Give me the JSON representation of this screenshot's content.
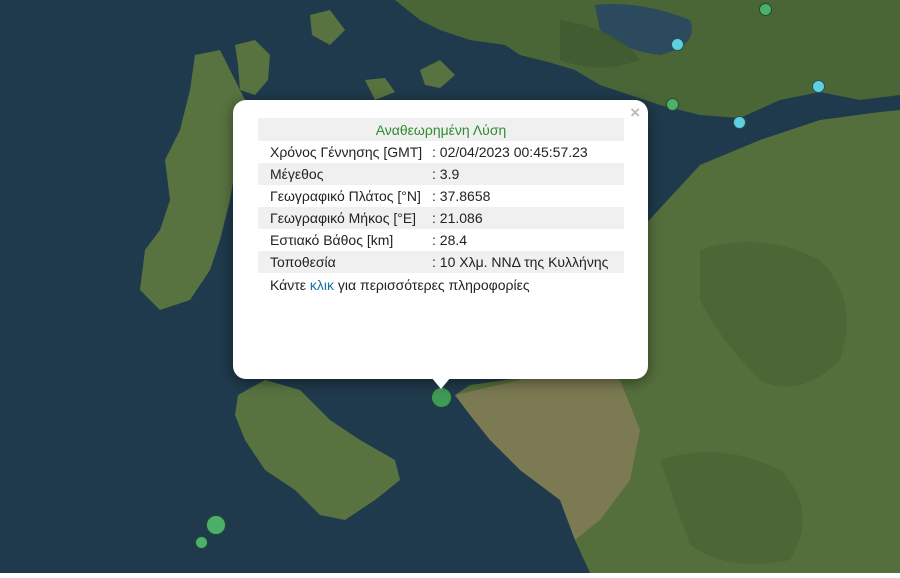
{
  "popup": {
    "title": "Αναθεωρημένη Λύση",
    "rows": [
      {
        "label": "Χρόνος Γέννησης [GMT]",
        "value": ": 02/04/2023 00:45:57.23"
      },
      {
        "label": "Μέγεθος",
        "value": ": 3.9"
      },
      {
        "label": "Γεωγραφικό Πλάτος [°N]",
        "value": ": 37.8658"
      },
      {
        "label": "Γεωγραφικό Μήκος [°E]",
        "value": ": 21.086"
      },
      {
        "label": "Εστιακό Βάθος [km]",
        "value": ": 28.4"
      },
      {
        "label": "Τοποθεσία",
        "value": ": 10 Χλμ. ΝΝΔ της Κυλλήνης"
      }
    ],
    "more_prefix": "Κάντε ",
    "more_link": "κλικ",
    "more_suffix": " για περισσότερες πληροφορίες",
    "close_label": "×"
  },
  "colors": {
    "sea": "#1f3a4c",
    "land": "#4f6b3a",
    "marker_green": "#4caf6a",
    "marker_cyan": "#5fd0e0",
    "header_text": "#2e8b2e",
    "link": "#1a6fa8"
  },
  "icons": {
    "close": "close-icon"
  }
}
